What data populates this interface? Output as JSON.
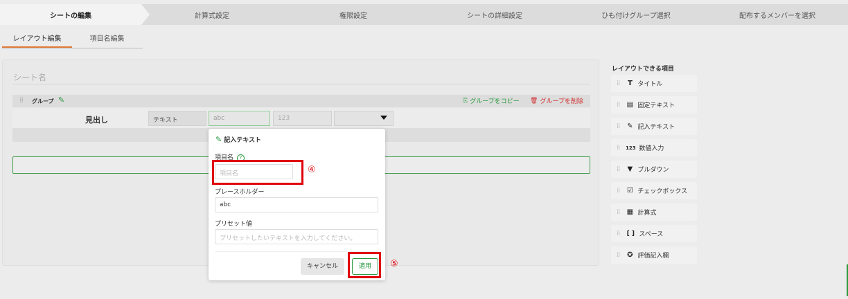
{
  "steps": [
    "シートの編集",
    "計算式設定",
    "権限設定",
    "シートの詳細設定",
    "ひも付けグループ選択",
    "配布するメンバーを選択"
  ],
  "subtabs": [
    "レイアウト編集",
    "項目名編集"
  ],
  "sheet": {
    "name_placeholder": "シート名"
  },
  "group": {
    "label": "グループ",
    "copy_label": "グループをコピー",
    "delete_label": "グループを削除"
  },
  "row": {
    "heading": "見出し",
    "type": "テキスト",
    "text_value": "abc",
    "number_value": "123"
  },
  "popup": {
    "title": "記入テキスト",
    "item_name_label": "項目名",
    "help": "?",
    "item_name_placeholder": "項目名",
    "placeholder_label": "プレースホルダー",
    "placeholder_value": "abc",
    "preset_label": "プリセット値",
    "preset_placeholder": "プリセットしたいテキストを入力してください。",
    "cancel": "キャンセル",
    "apply": "適用"
  },
  "annotations": {
    "step4": "④",
    "step5": "⑤"
  },
  "palette": {
    "title": "レイアウトできる項目",
    "items": [
      {
        "label": "タイトル",
        "icon": "T"
      },
      {
        "label": "固定テキスト",
        "icon": "▤"
      },
      {
        "label": "記入テキスト",
        "icon": "✎"
      },
      {
        "label": "数値入力",
        "icon": "123"
      },
      {
        "label": "プルダウン",
        "icon": "▼"
      },
      {
        "label": "チェックボックス",
        "icon": "☑"
      },
      {
        "label": "計算式",
        "icon": "▦"
      },
      {
        "label": "スペース",
        "icon": "[ ]"
      },
      {
        "label": "評価記入欄",
        "icon": "✪"
      }
    ]
  },
  "colors": {
    "accent_green": "#2a9a3e",
    "danger_red": "#d23030",
    "highlight_red": "#e0000a",
    "tab_orange": "#e07b39"
  }
}
